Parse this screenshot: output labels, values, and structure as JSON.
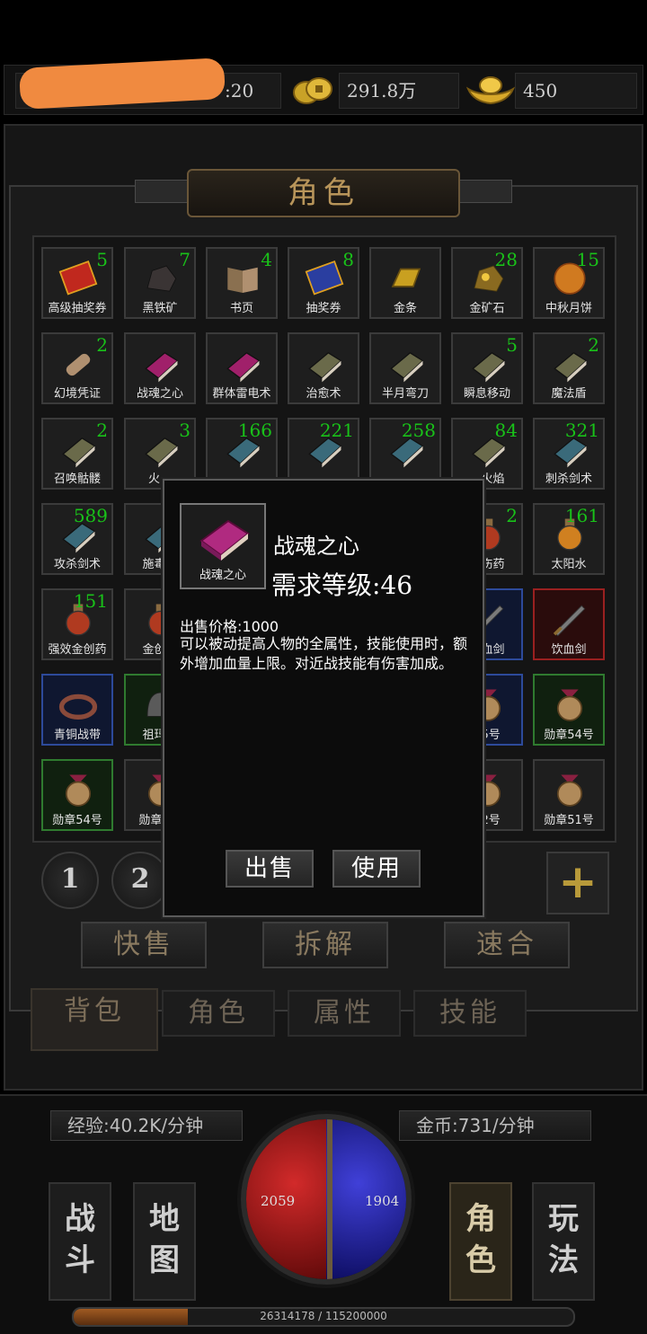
{
  "resources": {
    "level_text": ":20",
    "gold": "291.8万",
    "ingot": "450"
  },
  "panel": {
    "title": "角色"
  },
  "items": [
    {
      "name": "高级抽奖券",
      "count": "5",
      "style": "normal",
      "icon": "lottery-ticket-icon",
      "color": "#c0281e"
    },
    {
      "name": "黑铁矿",
      "count": "7",
      "style": "normal",
      "icon": "ore-icon",
      "color": "#3a3434"
    },
    {
      "name": "书页",
      "count": "4",
      "style": "normal",
      "icon": "book-page-icon",
      "color": "#8a7050"
    },
    {
      "name": "抽奖券",
      "count": "8",
      "style": "normal",
      "icon": "lottery-ticket-icon",
      "color": "#2a3ea0"
    },
    {
      "name": "金条",
      "count": "",
      "style": "normal",
      "icon": "gold-bar-icon",
      "color": "#c9a020"
    },
    {
      "name": "金矿石",
      "count": "28",
      "style": "normal",
      "icon": "gold-ore-icon",
      "color": "#8a6a20"
    },
    {
      "name": "中秋月饼",
      "count": "15",
      "style": "normal",
      "icon": "mooncake-icon",
      "color": "#d07a20"
    },
    {
      "name": "幻境凭证",
      "count": "2",
      "style": "normal",
      "icon": "scroll-icon",
      "color": "#b09070"
    },
    {
      "name": "战魂之心",
      "count": "",
      "style": "normal",
      "icon": "skill-book-icon",
      "color": "#a0206a"
    },
    {
      "name": "群体雷电术",
      "count": "",
      "style": "normal",
      "icon": "skill-book-icon",
      "color": "#a0206a"
    },
    {
      "name": "治愈术",
      "count": "",
      "style": "normal",
      "icon": "skill-book-icon",
      "color": "#6a6a4a"
    },
    {
      "name": "半月弯刀",
      "count": "",
      "style": "normal",
      "icon": "skill-book-icon",
      "color": "#6a6a4a"
    },
    {
      "name": "瞬息移动",
      "count": "5",
      "style": "normal",
      "icon": "skill-book-icon",
      "color": "#6a6a4a"
    },
    {
      "name": "魔法盾",
      "count": "2",
      "style": "normal",
      "icon": "skill-book-icon",
      "color": "#6a6a4a"
    },
    {
      "name": "召唤骷髅",
      "count": "2",
      "style": "normal",
      "icon": "skill-book-icon",
      "color": "#6a6a4a"
    },
    {
      "name": "火…",
      "count": "3",
      "style": "normal",
      "icon": "skill-book-icon",
      "color": "#6a6a4a"
    },
    {
      "name": "",
      "count": "166",
      "style": "normal",
      "icon": "skill-book-icon",
      "color": "#3a6a7a"
    },
    {
      "name": "",
      "count": "221",
      "style": "normal",
      "icon": "skill-book-icon",
      "color": "#3a6a7a"
    },
    {
      "name": "",
      "count": "258",
      "style": "normal",
      "icon": "skill-book-icon",
      "color": "#3a6a7a"
    },
    {
      "name": "…火焰",
      "count": "84",
      "style": "normal",
      "icon": "skill-book-icon",
      "color": "#6a6a4a"
    },
    {
      "name": "刺杀剑术",
      "count": "321",
      "style": "normal",
      "icon": "skill-book-icon",
      "color": "#3a6a7a"
    },
    {
      "name": "攻杀剑术",
      "count": "589",
      "style": "normal",
      "icon": "skill-book-icon",
      "color": "#3a6a7a"
    },
    {
      "name": "施毒…",
      "count": "",
      "style": "normal",
      "icon": "skill-book-icon",
      "color": "#3a6a7a"
    },
    {
      "name": "",
      "count": "",
      "style": "hidden",
      "icon": "",
      "color": ""
    },
    {
      "name": "",
      "count": "",
      "style": "hidden",
      "icon": "",
      "color": ""
    },
    {
      "name": "",
      "count": "",
      "style": "hidden",
      "icon": "",
      "color": ""
    },
    {
      "name": "…伤药",
      "count": "2",
      "style": "normal",
      "icon": "potion-icon",
      "color": "#b03a20"
    },
    {
      "name": "太阳水",
      "count": "161",
      "style": "normal",
      "icon": "potion-icon",
      "color": "#d08020"
    },
    {
      "name": "强效金创药",
      "count": "151",
      "style": "normal",
      "icon": "potion-icon",
      "color": "#b03a20"
    },
    {
      "name": "金创药",
      "count": "",
      "style": "normal",
      "icon": "potion-icon",
      "color": "#b03a20"
    },
    {
      "name": "",
      "count": "",
      "style": "hidden",
      "icon": "",
      "color": ""
    },
    {
      "name": "",
      "count": "",
      "style": "hidden",
      "icon": "",
      "color": ""
    },
    {
      "name": "",
      "count": "",
      "style": "hidden",
      "icon": "",
      "color": ""
    },
    {
      "name": "…血剑",
      "count": "",
      "style": "blue",
      "icon": "sword-icon",
      "color": "#7a7a7a"
    },
    {
      "name": "饮血剑",
      "count": "",
      "style": "red",
      "icon": "sword-icon",
      "color": "#7a7a7a"
    },
    {
      "name": "青铜战带",
      "count": "",
      "style": "blue",
      "icon": "belt-icon",
      "color": "#8a4a3a"
    },
    {
      "name": "祖玛…",
      "count": "",
      "style": "green",
      "icon": "helmet-icon",
      "color": "#5a5a5a"
    },
    {
      "name": "",
      "count": "",
      "style": "hidden",
      "icon": "",
      "color": ""
    },
    {
      "name": "",
      "count": "",
      "style": "hidden",
      "icon": "",
      "color": ""
    },
    {
      "name": "",
      "count": "",
      "style": "hidden",
      "icon": "",
      "color": ""
    },
    {
      "name": "55号",
      "count": "",
      "style": "blue",
      "icon": "medal-icon",
      "color": "#b08a5a"
    },
    {
      "name": "勋章54号",
      "count": "",
      "style": "green",
      "icon": "medal-icon",
      "color": "#b08a5a"
    },
    {
      "name": "勋章54号",
      "count": "",
      "style": "green",
      "icon": "medal-icon",
      "color": "#b08a5a"
    },
    {
      "name": "勋章5…",
      "count": "",
      "style": "normal",
      "icon": "medal-icon",
      "color": "#b08a5a"
    },
    {
      "name": "",
      "count": "",
      "style": "hidden",
      "icon": "",
      "color": ""
    },
    {
      "name": "",
      "count": "",
      "style": "hidden",
      "icon": "",
      "color": ""
    },
    {
      "name": "",
      "count": "",
      "style": "hidden",
      "icon": "",
      "color": ""
    },
    {
      "name": "52号",
      "count": "",
      "style": "normal",
      "icon": "medal-icon",
      "color": "#b08a5a"
    },
    {
      "name": "勋章51号",
      "count": "",
      "style": "normal",
      "icon": "medal-icon",
      "color": "#b08a5a"
    }
  ],
  "pages": [
    "1",
    "2"
  ],
  "add_label": "+",
  "actions": {
    "quick_sell": "快售",
    "dismantle": "拆解",
    "synthesize": "速合"
  },
  "tabs": {
    "bag": "背包",
    "role": "角色",
    "attr": "属性",
    "skill": "技能"
  },
  "hud": {
    "exp_rate": "经验:40.2K/分钟",
    "gold_rate": "金币:731/分钟",
    "hp": "2059",
    "mp": "1904",
    "exp_progress": "26314178 / 115200000",
    "exp_fraction": 0.228,
    "nav": {
      "battle": "战斗",
      "map": "地图",
      "role": "角色",
      "play": "玩法"
    }
  },
  "modal": {
    "icon_label": "战魂之心",
    "name": "战魂之心",
    "level": "需求等级:46",
    "price": "出售价格:1000",
    "description": "可以被动提高人物的全属性，技能使用时，额外增加血量上限。对近战技能有伤害加成。",
    "sell": "出售",
    "use": "使用"
  }
}
